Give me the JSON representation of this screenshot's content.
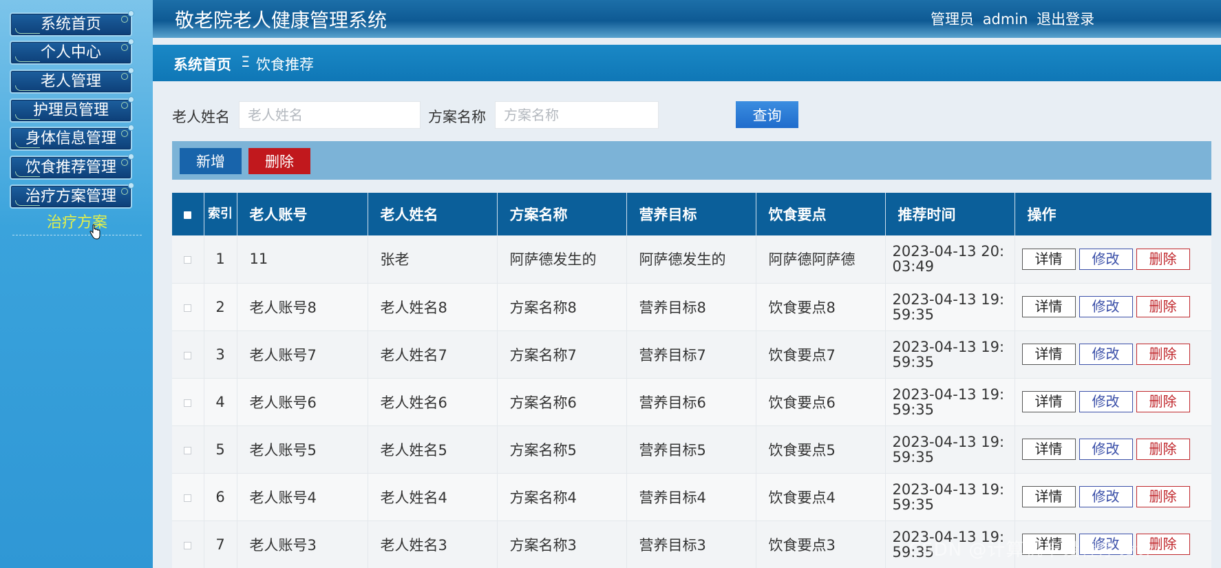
{
  "app": {
    "title": "敬老院老人健康管理系统"
  },
  "header": {
    "role": "管理员",
    "username": "admin",
    "logout": "退出登录"
  },
  "sidebar": {
    "items": [
      {
        "label": "系统首页"
      },
      {
        "label": "个人中心"
      },
      {
        "label": "老人管理"
      },
      {
        "label": "护理员管理"
      },
      {
        "label": "身体信息管理"
      },
      {
        "label": "饮食推荐管理"
      },
      {
        "label": "治疗方案管理"
      }
    ],
    "submenu_item": "治疗方案"
  },
  "breadcrumb": {
    "home": "系统首页",
    "separator": "Ξ",
    "current": "饮食推荐"
  },
  "search": {
    "name_label": "老人姓名",
    "name_placeholder": "老人姓名",
    "plan_label": "方案名称",
    "plan_placeholder": "方案名称",
    "query_button": "查询"
  },
  "actions": {
    "add": "新增",
    "delete": "删除"
  },
  "table": {
    "headers": {
      "index": "索引",
      "account": "老人账号",
      "name": "老人姓名",
      "plan": "方案名称",
      "goal": "营养目标",
      "points": "饮食要点",
      "time": "推荐时间",
      "ops": "操作"
    },
    "op_labels": {
      "detail": "详情",
      "edit": "修改",
      "delete": "删除"
    },
    "rows": [
      {
        "index": "1",
        "account": "11",
        "name": "张老",
        "plan": "阿萨德发生的",
        "goal": "阿萨德发生的",
        "points": "阿萨德阿萨德",
        "time_a": "2023-04-13 20:",
        "time_b": "03:49"
      },
      {
        "index": "2",
        "account": "老人账号8",
        "name": "老人姓名8",
        "plan": "方案名称8",
        "goal": "营养目标8",
        "points": "饮食要点8",
        "time_a": "2023-04-13 19:",
        "time_b": "59:35"
      },
      {
        "index": "3",
        "account": "老人账号7",
        "name": "老人姓名7",
        "plan": "方案名称7",
        "goal": "营养目标7",
        "points": "饮食要点7",
        "time_a": "2023-04-13 19:",
        "time_b": "59:35"
      },
      {
        "index": "4",
        "account": "老人账号6",
        "name": "老人姓名6",
        "plan": "方案名称6",
        "goal": "营养目标6",
        "points": "饮食要点6",
        "time_a": "2023-04-13 19:",
        "time_b": "59:35"
      },
      {
        "index": "5",
        "account": "老人账号5",
        "name": "老人姓名5",
        "plan": "方案名称5",
        "goal": "营养目标5",
        "points": "饮食要点5",
        "time_a": "2023-04-13 19:",
        "time_b": "59:35"
      },
      {
        "index": "6",
        "account": "老人账号4",
        "name": "老人姓名4",
        "plan": "方案名称4",
        "goal": "营养目标4",
        "points": "饮食要点4",
        "time_a": "2023-04-13 19:",
        "time_b": "59:35"
      },
      {
        "index": "7",
        "account": "老人账号3",
        "name": "老人姓名3",
        "plan": "方案名称3",
        "goal": "营养目标3",
        "points": "饮食要点3",
        "time_a": "2023-04-13 19:",
        "time_b": "59:35"
      }
    ]
  },
  "watermark": "CSDN @计算机毕设程序设计",
  "colors": {
    "header": "#0e5a94",
    "table_header": "#0b5f9a",
    "submenu_active": "#e4f04a",
    "danger": "#c1181d",
    "primary": "#1864ab"
  }
}
